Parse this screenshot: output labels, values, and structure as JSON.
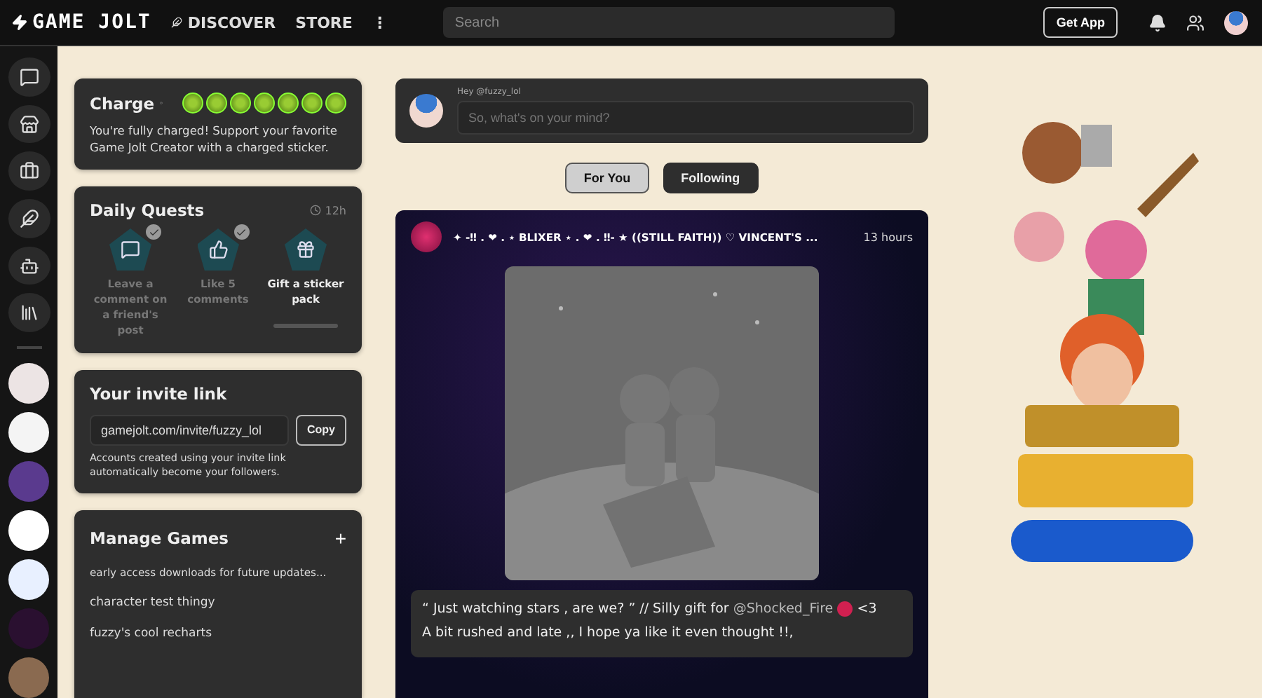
{
  "topbar": {
    "logo": "GAME JOLT",
    "nav": [
      {
        "label": "DISCOVER",
        "kind": "icon-link"
      },
      {
        "label": "STORE",
        "kind": "link"
      }
    ],
    "more": "⋮",
    "search": {
      "placeholder": "Search"
    },
    "get_app": "Get App"
  },
  "rail": {
    "items": [
      {
        "kind": "chat"
      },
      {
        "kind": "store"
      },
      {
        "kind": "bag"
      },
      {
        "kind": "quill"
      },
      {
        "kind": "robot"
      },
      {
        "kind": "library"
      }
    ],
    "avatars": [
      {
        "color": "#ece4e4"
      },
      {
        "color": "#f4f4f4"
      },
      {
        "color": "#5a3a8e"
      },
      {
        "color": "#ffffff"
      },
      {
        "color": "#e8f0ff"
      },
      {
        "color": "#2a1030"
      },
      {
        "color": "#8a6a50"
      }
    ]
  },
  "charge": {
    "title": "Charge",
    "text": "You're fully charged! Support your favorite Game Jolt Creator with a charged sticker."
  },
  "quests": {
    "title": "Daily Quests",
    "timer": "12h",
    "items": [
      {
        "label": "Leave a comment on a friend's post",
        "completed": true,
        "kind": "comment"
      },
      {
        "label": "Like 5 comments",
        "completed": true,
        "kind": "like"
      },
      {
        "label": "Gift a sticker pack",
        "completed": false,
        "kind": "gift"
      }
    ]
  },
  "invite": {
    "title": "Your invite link",
    "value": "gamejolt.com/invite/fuzzy_lol",
    "copy": "Copy",
    "note": "Accounts created using your invite link automatically become your followers."
  },
  "manage": {
    "title": "Manage Games",
    "add": "+",
    "games": [
      "early access downloads for future updates...",
      "character test thingy",
      "fuzzy's cool recharts"
    ]
  },
  "composer": {
    "greeting": "Hey @fuzzy_lol",
    "placeholder": "So, what's on your mind?"
  },
  "feed_tabs": [
    {
      "label": "For You",
      "selected": true
    },
    {
      "label": "Following",
      "selected": false
    }
  ],
  "post": {
    "title": "✦ -‼ . ❤ . ⋆ BLIXER ⋆ . ❤ . ‼- ★ ((STILL FAITH)) ♡ VINCENT'S ...",
    "time": "13 hours",
    "caption": [
      {
        "text": "“ Just watching stars , are we? ” // Silly gift for ",
        "mention": "@Shocked_Fire",
        "after": "<3"
      },
      {
        "text": "A bit rushed and late ,, I hope ya like it even thought !!,"
      }
    ]
  }
}
